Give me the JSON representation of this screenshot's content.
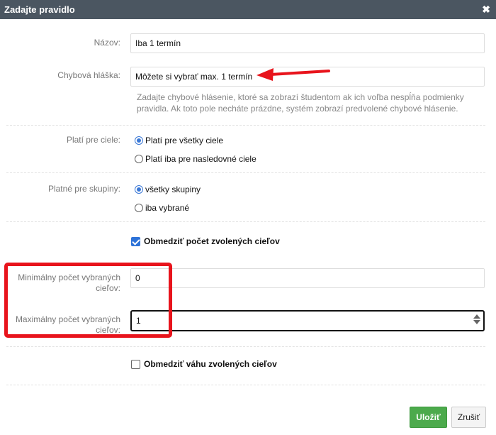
{
  "dialog": {
    "title": "Zadajte pravidlo",
    "close_glyph": "✖"
  },
  "colors": {
    "annotation_red": "#e8141c",
    "primary_green": "#4caa4c",
    "accent_blue": "#2e73d8"
  },
  "form": {
    "name": {
      "label": "Názov:",
      "value": "Iba 1 termín"
    },
    "error_message": {
      "label": "Chybová hláška:",
      "value": "Môžete si vybrať max. 1 termín",
      "help": "Zadajte chybové hlásenie, ktoré sa zobrazí študentom ak ich voľba nespĺňa podmienky pravidla. Ak toto pole necháte prázdne, systém zobrazí predvolené chybové hlásenie."
    },
    "targets": {
      "label": "Platí pre ciele:",
      "options": [
        {
          "label": "Platí pre všetky ciele",
          "selected": true
        },
        {
          "label": "Platí iba pre nasledovné ciele",
          "selected": false
        }
      ]
    },
    "groups": {
      "label": "Platné pre skupiny:",
      "options": [
        {
          "label": "všetky skupiny",
          "selected": true
        },
        {
          "label": "iba vybrané",
          "selected": false
        }
      ]
    },
    "limit_count": {
      "label": "Obmedziť počet zvolených cieľov",
      "checked": true
    },
    "min_count": {
      "label": "Minimálny počet vybraných cieľov:",
      "value": "0"
    },
    "max_count": {
      "label": "Maximálny počet vybraných cieľov:",
      "value": "1"
    },
    "limit_weight": {
      "label": "Obmedziť váhu zvolených cieľov",
      "checked": false
    }
  },
  "footer": {
    "save_label": "Uložiť",
    "cancel_label": "Zrušiť"
  },
  "icons": {
    "close": "close-icon",
    "arrow": "red-arrow-annotation",
    "spinner": "number-spinner-icon"
  }
}
